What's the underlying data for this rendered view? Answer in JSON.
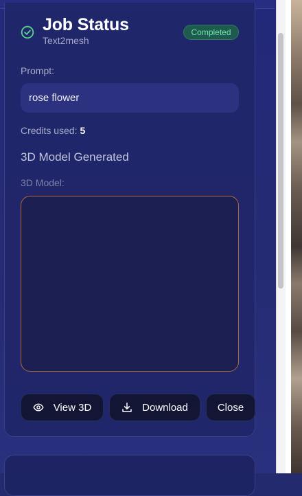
{
  "header": {
    "title": "Job Status",
    "subtitle": "Text2mesh",
    "badge": "Completed"
  },
  "prompt": {
    "label": "Prompt:",
    "value": "rose flower"
  },
  "credits": {
    "label": "Credits used:",
    "value": "5"
  },
  "result": {
    "heading": "3D Model Generated",
    "model_label": "3D Model:"
  },
  "actions": {
    "view": "View 3D",
    "download": "Download",
    "close": "Close"
  },
  "icons": {
    "status": "check-circle-icon",
    "view": "eye-icon",
    "download": "download-icon"
  },
  "colors": {
    "badge_text": "#6ee7a8",
    "badge_bg": "#1f5a4e",
    "viewer_border": "#b0673f",
    "status_icon": "#5ad48f"
  }
}
